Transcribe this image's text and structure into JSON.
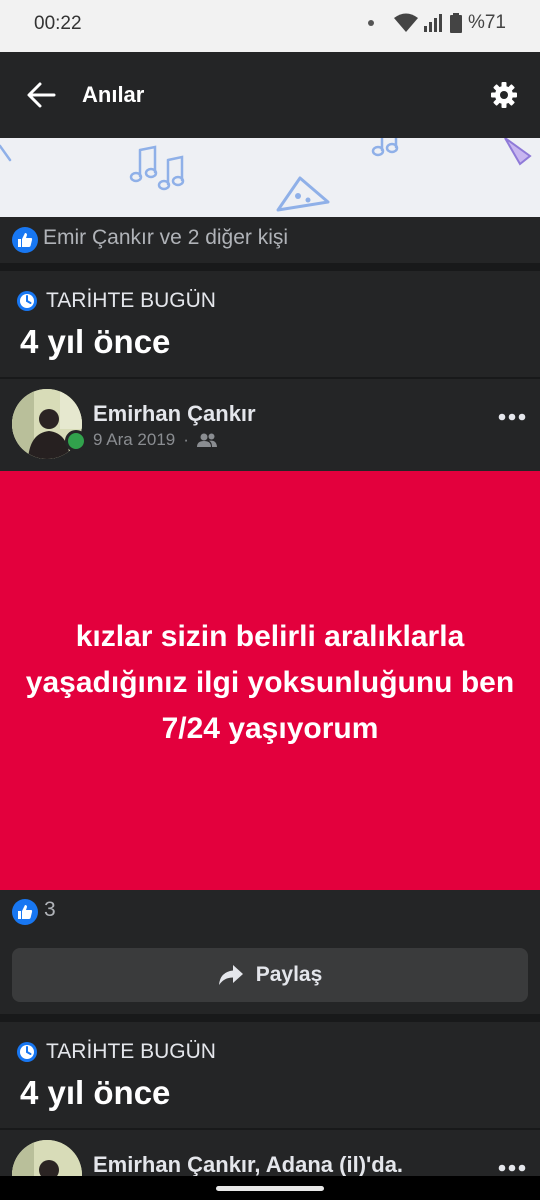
{
  "status_bar": {
    "time": "00:22",
    "battery": "%71"
  },
  "app_bar": {
    "title": "Anılar",
    "icons": [
      "back-arrow-icon",
      "gear-icon"
    ]
  },
  "likes_summary": {
    "text": "Emir Çankır ve 2 diğer kişi"
  },
  "sections": [
    {
      "label": "TARİHTE BUGÜN",
      "title": "4 yıl önce"
    },
    {
      "label": "TARİHTE BUGÜN",
      "title": "4 yıl önce"
    }
  ],
  "post": {
    "author": "Emirhan Çankır",
    "date": "9 Ara 2019",
    "separator": "·",
    "body": "kızlar sizin belirli aralıklarla yaşadığınız ilgi yoksunluğunu ben 7/24 yaşıyorum",
    "background_color": "#e3003d",
    "reactions": "3",
    "share_label": "Paylaş"
  },
  "next_post": {
    "author_line": "Emirhan Çankır, Adana (il)'da."
  },
  "colors": {
    "accent": "#1877f2",
    "online": "#31a24c",
    "surface": "#242526",
    "background": "#18191a"
  }
}
